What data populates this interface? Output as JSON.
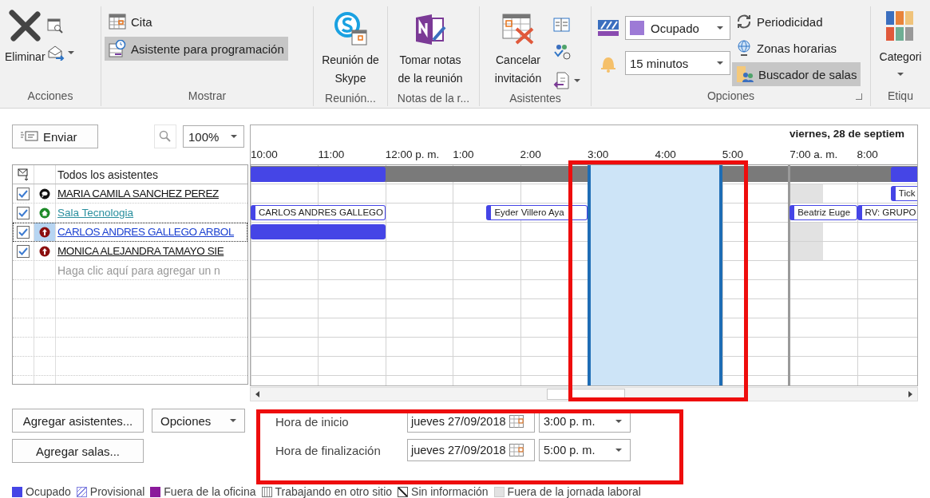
{
  "ribbon": {
    "groups": [
      {
        "label": "Acciones",
        "buttons": [
          {
            "label": "Eliminar"
          }
        ]
      },
      {
        "label": "Mostrar",
        "buttons": [
          {
            "label": "Cita",
            "selected": false
          },
          {
            "label": "Asistente para programación",
            "selected": true
          }
        ]
      },
      {
        "label": "Reunión...",
        "buttons": [
          {
            "label": "Reunión de Skype"
          }
        ]
      },
      {
        "label": "Notas de la r...",
        "buttons": [
          {
            "label": "Tomar notas de la reunión"
          }
        ]
      },
      {
        "label": "Asistentes",
        "buttons": [
          {
            "label": "Cancelar invitación"
          }
        ]
      },
      {
        "label": "Opciones",
        "show_as": "Ocupado",
        "reminder": "15 minutos",
        "buttons": [
          {
            "label": "Periodicidad",
            "selected": false
          },
          {
            "label": "Zonas horarias",
            "selected": false
          },
          {
            "label": "Buscador de salas",
            "selected": true
          }
        ]
      },
      {
        "label": "Etiqu",
        "buttons": [
          {
            "label": "Categori"
          }
        ]
      }
    ]
  },
  "toolbar": {
    "send": "Enviar",
    "zoom": "100%"
  },
  "attendees": {
    "header": "Todos los asistentes",
    "placeholder": "Haga clic aquí para agregar un n",
    "rows": [
      {
        "name": "MARIA CAMILA SANCHEZ PEREZ",
        "kind": "organizer",
        "checked": true,
        "selected": false
      },
      {
        "name": "Sala Tecnologia",
        "kind": "room",
        "checked": true,
        "selected": false
      },
      {
        "name": "CARLOS ANDRES GALLEGO ARBOL",
        "kind": "required",
        "checked": true,
        "selected": true
      },
      {
        "name": "MONICA ALEJANDRA TAMAYO SIE",
        "kind": "required",
        "checked": true,
        "selected": false
      }
    ]
  },
  "schedule": {
    "date": "viernes, 28 de septiem",
    "hours": [
      "10:00",
      "11:00",
      "12:00 p. m.",
      "1:00",
      "2:00",
      "3:00",
      "4:00",
      "5:00",
      "7:00 a. m.",
      "8:00"
    ],
    "rows": [
      {
        "kind": "summary",
        "events": [
          {
            "kind": "busy"
          },
          {
            "kind": "busy"
          }
        ]
      },
      {
        "kind": "attendee",
        "events": [
          {
            "kind": "off_hours"
          },
          {
            "kind": "meeting",
            "label": "Tick"
          }
        ]
      },
      {
        "kind": "attendee",
        "events": [
          {
            "kind": "meeting",
            "label": "CARLOS ANDRES GALLEGO"
          },
          {
            "kind": "meeting",
            "label": "Eyder Villero Aya"
          },
          {
            "kind": "meeting",
            "label": "Beatriz Euge"
          },
          {
            "kind": "meeting",
            "label": "RV: GRUPO"
          }
        ]
      },
      {
        "kind": "attendee",
        "events": [
          {
            "kind": "busy"
          },
          {
            "kind": "off_hours"
          }
        ]
      },
      {
        "kind": "attendee",
        "events": [
          {
            "kind": "off_hours"
          }
        ]
      }
    ]
  },
  "buttons": {
    "add_attendees": "Agregar asistentes...",
    "options": "Opciones",
    "add_rooms": "Agregar salas..."
  },
  "times": [
    {
      "label": "Hora de inicio",
      "date": "jueves 27/09/2018",
      "time": "3:00 p. m."
    },
    {
      "label": "Hora de finalización",
      "date": "jueves 27/09/2018",
      "time": "5:00 p. m."
    }
  ],
  "legend": [
    {
      "label": "Ocupado",
      "kind": "busy"
    },
    {
      "label": "Provisional",
      "kind": "tentative"
    },
    {
      "label": "Fuera de la oficina",
      "kind": "out_of_office"
    },
    {
      "label": "Trabajando en otro sitio",
      "kind": "elsewhere"
    },
    {
      "label": "Sin información",
      "kind": "no_info"
    },
    {
      "label": "Fuera de la jornada laboral",
      "kind": "off_hours"
    }
  ]
}
